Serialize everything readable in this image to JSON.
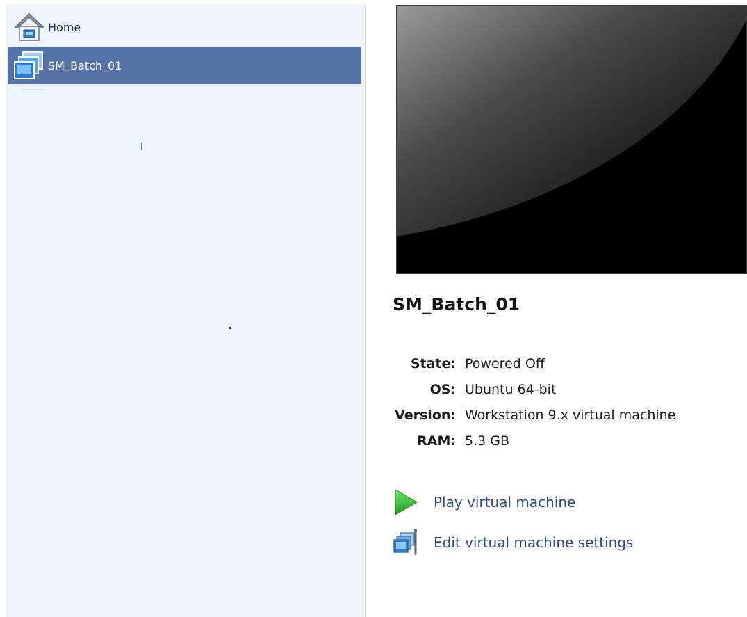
{
  "sidebar": {
    "items": [
      {
        "label": "Home",
        "icon": "home-icon"
      },
      {
        "label": "SM_Batch_01",
        "icon": "virtual-machine-icon",
        "selected": true
      }
    ]
  },
  "vm": {
    "name": "SM_Batch_01",
    "details": [
      {
        "key": "State:",
        "value": "Powered Off"
      },
      {
        "key": "OS:",
        "value": "Ubuntu 64-bit"
      },
      {
        "key": "Version:",
        "value": "Workstation 9.x virtual machine"
      },
      {
        "key": "RAM:",
        "value": "5.3 GB"
      }
    ],
    "actions": {
      "play": {
        "label": "Play virtual machine",
        "icon": "play-icon"
      },
      "edit": {
        "label": "Edit virtual machine settings",
        "icon": "vm-settings-icon"
      }
    }
  },
  "colors": {
    "sidebar_bg": "#eef4fb",
    "selection": "#5673a8",
    "link": "#2b4a86",
    "play_green": "#2fb52f"
  }
}
